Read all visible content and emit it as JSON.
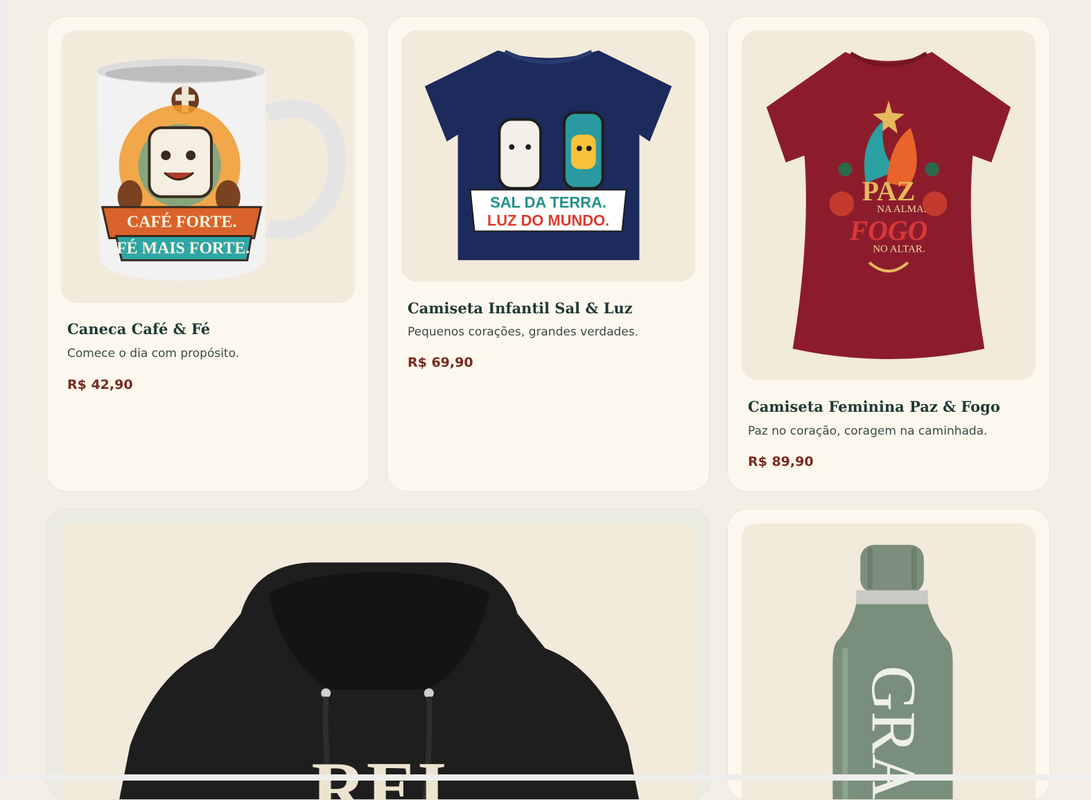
{
  "colors": {
    "page_background": "#f4efe5",
    "card_background": "#fdf8ee",
    "image_background": "#f2eadb",
    "title": "#1f3a32",
    "price": "#7a2b20"
  },
  "products": [
    {
      "name": "Caneca Café & Fé",
      "description": "Comece o dia com propósito.",
      "price": "R$ 42,90",
      "artwork": [
        "CAFÉ FORTE.",
        "FÉ MAIS FORTE."
      ]
    },
    {
      "name": "Camiseta Infantil Sal & Luz",
      "description": "Pequenos corações, grandes verdades.",
      "price": "R$ 69,90",
      "artwork": [
        "SAL DA TERRA.",
        "LUZ DO MUNDO."
      ]
    },
    {
      "name": "Camiseta Feminina Paz & Fogo",
      "description": "Paz no coração, coragem na caminhada.",
      "price": "R$ 89,90",
      "artwork": [
        "PAZ",
        "NA ALMA.",
        "FOGO",
        "NO ALTAR."
      ]
    },
    {
      "artwork": [
        "REI"
      ]
    },
    {
      "artwork": [
        "GRA"
      ]
    }
  ]
}
